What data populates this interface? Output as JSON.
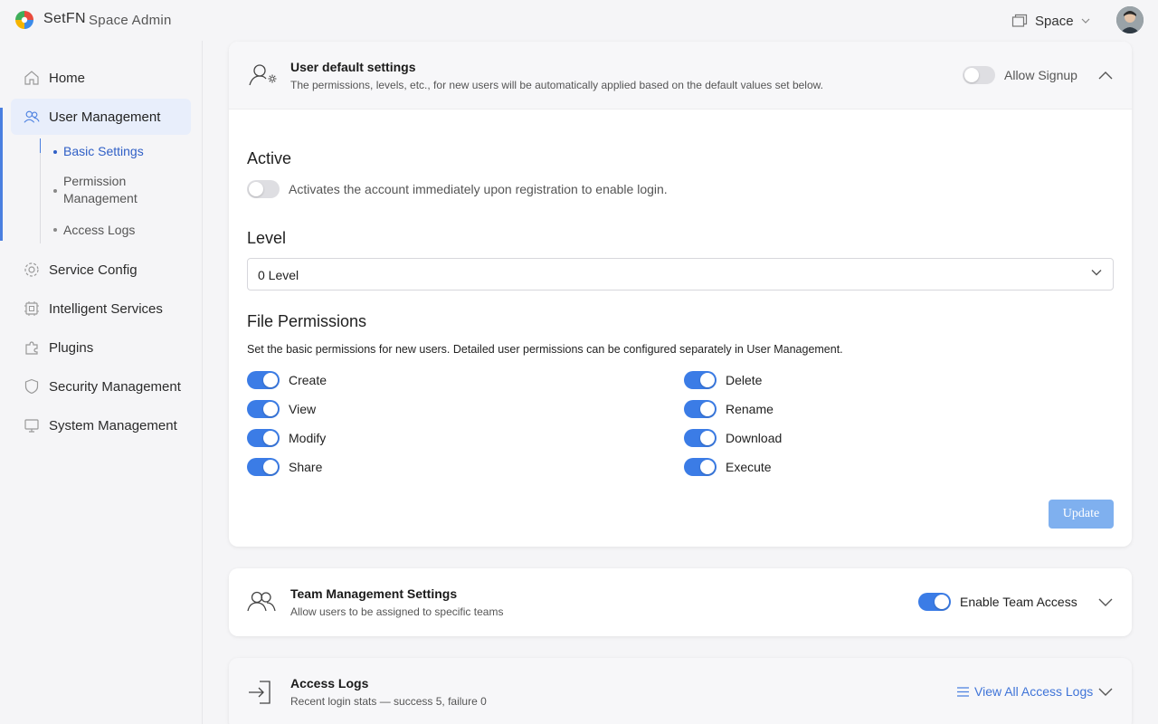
{
  "header": {
    "brand": "SetFN",
    "brand_sub": "Space Admin",
    "space_label": "Space"
  },
  "sidebar": {
    "items": [
      {
        "label": "Home",
        "icon": "home-icon"
      },
      {
        "label": "User Management",
        "icon": "users-icon"
      },
      {
        "label": "Service Config",
        "icon": "gear-icon"
      },
      {
        "label": "Intelligent Services",
        "icon": "chip-icon"
      },
      {
        "label": "Plugins",
        "icon": "puzzle-icon"
      },
      {
        "label": "Security Management",
        "icon": "shield-icon"
      },
      {
        "label": "System Management",
        "icon": "monitor-icon"
      }
    ],
    "sub_items": [
      {
        "label": "Basic Settings"
      },
      {
        "label": "Permission Management"
      },
      {
        "label": "Access Logs"
      }
    ]
  },
  "user_defaults": {
    "title": "User default settings",
    "subtitle": "The permissions, levels, etc., for new users will be automatically applied based on the default values set below.",
    "allow_signup_label": "Allow Signup",
    "allow_signup": false,
    "active_heading": "Active",
    "active_desc": "Activates the account immediately upon registration to enable login.",
    "active": false,
    "level_heading": "Level",
    "level_value": "0 Level",
    "file_perm_heading": "File Permissions",
    "file_perm_desc": "Set the basic permissions for new users. Detailed user permissions can be configured separately in User Management.",
    "permissions_left": [
      {
        "label": "Create",
        "on": true
      },
      {
        "label": "View",
        "on": true
      },
      {
        "label": "Modify",
        "on": true
      },
      {
        "label": "Share",
        "on": true
      }
    ],
    "permissions_right": [
      {
        "label": "Delete",
        "on": true
      },
      {
        "label": "Rename",
        "on": true
      },
      {
        "label": "Download",
        "on": true
      },
      {
        "label": "Execute",
        "on": true
      }
    ],
    "update_label": "Update"
  },
  "team": {
    "title": "Team Management Settings",
    "subtitle": "Allow users to be assigned to specific teams",
    "toggle_label": "Enable Team Access",
    "enabled": true
  },
  "access_logs": {
    "title": "Access Logs",
    "subtitle": "Recent login stats — success 5, failure 0",
    "view_all_label": "View All Access Logs"
  },
  "colors": {
    "accent": "#3b7ce6",
    "active_nav_bg": "#e8eefb",
    "button_bg": "#7fb0ef"
  }
}
